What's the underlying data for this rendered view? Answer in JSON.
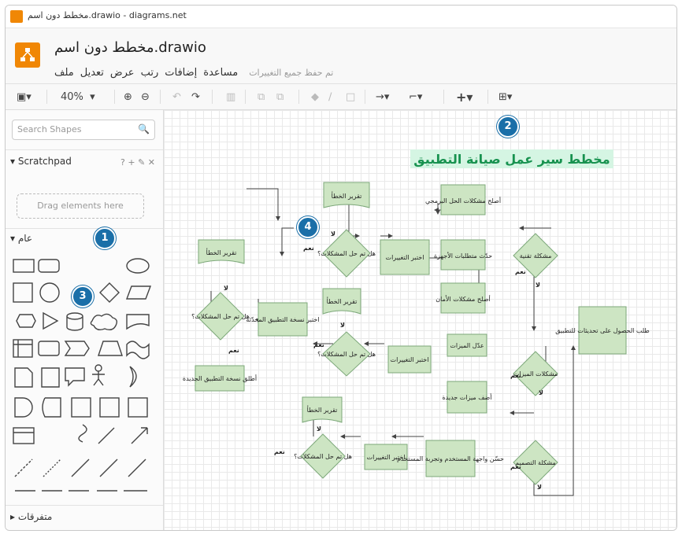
{
  "window": {
    "title": "مخطط دون اسم.drawio - diagrams.net"
  },
  "document": {
    "title": "مخطط دون اسم.drawio",
    "save_status": "تم حفظ جميع التغييرات"
  },
  "menu": [
    "ملف",
    "تعديل",
    "عرض",
    "رتب",
    "إضافات",
    "مساعدة"
  ],
  "toolbar": {
    "zoom": "40%"
  },
  "sidebar": {
    "search_placeholder": "Search Shapes",
    "scratchpad_title": "Scratchpad",
    "scratchpad_tools": "? + ✎ ✕",
    "drag_hint": "Drag elements here",
    "general_title": "عام",
    "misc_title": "متفرقات"
  },
  "canvas": {
    "title": "مخطط سير عمل صيانة التطبيق"
  },
  "badges": [
    "1",
    "2",
    "3",
    "4"
  ],
  "flowchart": {
    "nodes": {
      "report_tr": "تقرير الخطأ",
      "report_l": "تقرير الخطأ",
      "report_m": "تقرير الخطأ",
      "report_b": "تقرير الخطأ",
      "fix_soft": "أصلح مشكلات الحل البرمجي",
      "update_hw": "حدّث متطلبات الأجهزة",
      "fix_sec": "أصلح مشكلات الأمان",
      "test_top": "اختبر التغييرات",
      "test_mid": "اختبر التغييرات",
      "test_bot": "اختبر التغييرات",
      "q_top": "هل تم حل المشكلات؟",
      "q_left": "هل تم حل المشكلات؟",
      "q_mid": "هل تم حل المشكلات؟",
      "q_bot": "هل تم حل المشكلات؟",
      "tech_issue": "مشكلة تقنية",
      "feature_issue": "مشكلات الميزات",
      "design_issue": "مشكلة التصميم",
      "request": "طلب الحصول على تحديثات للتطبيق",
      "backup": "اختبر نسخة التطبيق المحدّثة",
      "release": "أطلق نسخة التطبيق الجديدة",
      "edit_feat": "عدّل الميزات",
      "add_feat": "أضف ميزات جديدة",
      "improve_ui": "حسّن واجهة المستخدم وتجربة المستخدم"
    },
    "labels": {
      "yes": "نعم",
      "no": "لا"
    }
  }
}
